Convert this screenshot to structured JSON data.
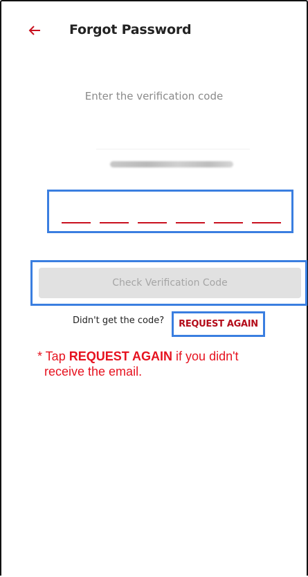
{
  "header": {
    "back_icon": "arrow-left-icon",
    "title": "Forgot Password"
  },
  "verification": {
    "instruction": "Enter the verification code",
    "masked_email": "(masked email address)",
    "code_length": 6
  },
  "actions": {
    "check_button_label": "Check Verification Code",
    "prompt_text": "Didn't get the code?",
    "request_again_label": "REQUEST AGAIN"
  },
  "note": {
    "prefix": "* Tap ",
    "bold": "REQUEST AGAIN",
    "suffix_line1": " if you didn't",
    "line2": "receive the email."
  },
  "colors": {
    "accent_red": "#c8101e",
    "highlight_blue": "#3a7ee0",
    "note_red": "#e6121f",
    "disabled_button": "#e1e1e1"
  }
}
